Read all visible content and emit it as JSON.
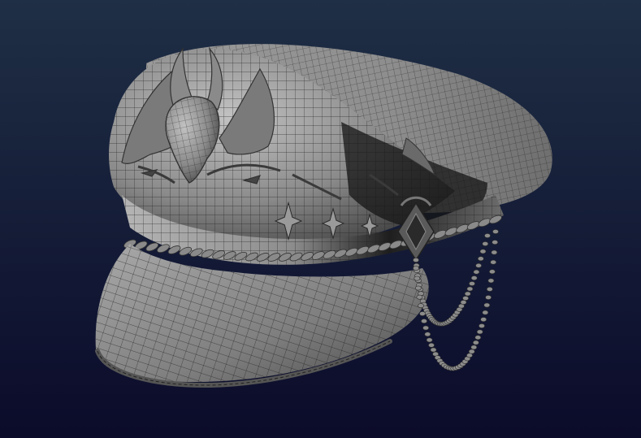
{
  "scene": {
    "subject_icon": "wireframe-peaked-cap-icon",
    "colors": {
      "background_top": "#1f2f45",
      "background_bottom": "#0b0b2a",
      "mesh_light": "#b7b7b7",
      "mesh_mid": "#777777",
      "mesh_dark": "#2a2a2a",
      "wire": "#222222"
    }
  }
}
